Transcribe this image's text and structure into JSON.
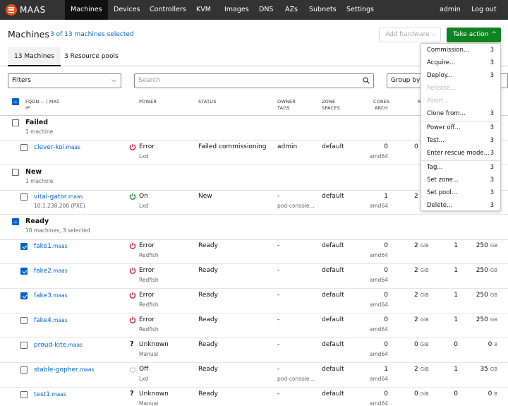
{
  "brand": {
    "name": "MAAS",
    "accent": "#e95420"
  },
  "nav": {
    "items": [
      "Machines",
      "Devices",
      "Controllers",
      "KVM",
      "Images",
      "DNS",
      "AZs",
      "Subnets",
      "Settings"
    ],
    "user": "admin",
    "logout": "Log out"
  },
  "header": {
    "title": "Machines",
    "selection": "3 of 13 machines selected",
    "add_hardware": "Add hardware",
    "take_action": "Take action"
  },
  "tabs": [
    "13 Machines",
    "3 Resource pools"
  ],
  "filters": {
    "label": "Filters",
    "search_placeholder": "Search",
    "group_by": "Group by s"
  },
  "columns": {
    "fqdn": "FQDN",
    "mac": "| MAC",
    "ip": "IP",
    "power": "POWER",
    "status": "STATUS",
    "owner": "OWNER",
    "tags": "TAGS",
    "zone": "ZONE",
    "spaces": "SPACES",
    "cores": "CORES",
    "arch": "ARCH",
    "ram_partial": "R"
  },
  "groups": [
    {
      "name": "Failed",
      "count": "1 machine"
    },
    {
      "name": "New",
      "count": "1 machine"
    },
    {
      "name": "Ready",
      "count": "10 machines, 3 selected"
    }
  ],
  "machines": [
    {
      "host": "clever-koi",
      "domain": ".maas",
      "ip": "",
      "power": "Error",
      "power_type": "Lxd",
      "status": "Failed commissioning",
      "owner": "admin",
      "tags": "",
      "zone": "default",
      "cores": "0",
      "arch": "amd64",
      "ram": "0",
      "ram_unit": "",
      "disks": "",
      "storage": "",
      "storage_unit": "",
      "checked": false
    },
    {
      "host": "vital-gator",
      "domain": ".maas",
      "ip": "10.1.238.200 (PXE)",
      "power": "On",
      "power_type": "Lxd",
      "status": "New",
      "owner": "-",
      "tags": "pod-console...",
      "zone": "default",
      "cores": "1",
      "arch": "amd64",
      "ram": "2",
      "ram_unit": "",
      "disks": "",
      "storage": "",
      "storage_unit": "",
      "checked": false
    },
    {
      "host": "fake1",
      "domain": ".maas",
      "ip": "",
      "power": "Error",
      "power_type": "Redfish",
      "status": "Ready",
      "owner": "-",
      "tags": "",
      "zone": "default",
      "cores": "0",
      "arch": "amd64",
      "ram": "2",
      "ram_unit": "GiB",
      "disks": "1",
      "storage": "250",
      "storage_unit": "GB",
      "checked": true
    },
    {
      "host": "fake2",
      "domain": ".maas",
      "ip": "",
      "power": "Error",
      "power_type": "Redfish",
      "status": "Ready",
      "owner": "-",
      "tags": "",
      "zone": "default",
      "cores": "0",
      "arch": "amd64",
      "ram": "2",
      "ram_unit": "GiB",
      "disks": "1",
      "storage": "250",
      "storage_unit": "GB",
      "checked": true
    },
    {
      "host": "fake3",
      "domain": ".maas",
      "ip": "",
      "power": "Error",
      "power_type": "Redfish",
      "status": "Ready",
      "owner": "-",
      "tags": "",
      "zone": "default",
      "cores": "0",
      "arch": "amd64",
      "ram": "2",
      "ram_unit": "GiB",
      "disks": "1",
      "storage": "250",
      "storage_unit": "GB",
      "checked": true
    },
    {
      "host": "fake4",
      "domain": ".maas",
      "ip": "",
      "power": "Error",
      "power_type": "Redfish",
      "status": "Ready",
      "owner": "-",
      "tags": "",
      "zone": "default",
      "cores": "0",
      "arch": "amd64",
      "ram": "2",
      "ram_unit": "GiB",
      "disks": "1",
      "storage": "250",
      "storage_unit": "GB",
      "checked": false
    },
    {
      "host": "proud-kite",
      "domain": ".maas",
      "ip": "",
      "power": "Unknown",
      "power_type": "Manual",
      "status": "Ready",
      "owner": "-",
      "tags": "",
      "zone": "default",
      "cores": "0",
      "arch": "amd64",
      "ram": "0",
      "ram_unit": "GiB",
      "disks": "0",
      "storage": "0",
      "storage_unit": "B",
      "checked": false
    },
    {
      "host": "stable-gopher",
      "domain": ".maas",
      "ip": "",
      "power": "Off",
      "power_type": "Lxd",
      "status": "Ready",
      "owner": "-",
      "tags": "pod-console...",
      "zone": "default",
      "cores": "1",
      "arch": "amd64",
      "ram": "2",
      "ram_unit": "GiB",
      "disks": "1",
      "storage": "35",
      "storage_unit": "GB",
      "checked": false
    },
    {
      "host": "test1",
      "domain": ".maas",
      "ip": "",
      "power": "Unknown",
      "power_type": "Manual",
      "status": "Ready",
      "owner": "-",
      "tags": "",
      "zone": "default",
      "cores": "0",
      "arch": "amd64",
      "ram": "0",
      "ram_unit": "GiB",
      "disks": "0",
      "storage": "0",
      "storage_unit": "B",
      "checked": false
    }
  ],
  "power_colors": {
    "error": "#c7162b",
    "on": "#0e8420",
    "off": "#cccccc"
  },
  "menu": [
    {
      "label": "Commission...",
      "count": "3",
      "disabled": false
    },
    {
      "label": "Acquire...",
      "count": "3",
      "disabled": false
    },
    {
      "label": "Deploy...",
      "count": "3",
      "disabled": false
    },
    {
      "label": "Release...",
      "count": "",
      "disabled": true
    },
    {
      "label": "Abort...",
      "count": "",
      "disabled": true
    },
    {
      "label": "Clone from...",
      "count": "3",
      "disabled": false
    },
    {
      "label": "Power off...",
      "count": "3",
      "disabled": false
    },
    {
      "label": "Test...",
      "count": "3",
      "disabled": false
    },
    {
      "label": "Enter rescue mode...",
      "count": "3",
      "disabled": false
    },
    {
      "label": "Tag...",
      "count": "3",
      "disabled": false
    },
    {
      "label": "Set zone...",
      "count": "3",
      "disabled": false
    },
    {
      "label": "Set pool...",
      "count": "3",
      "disabled": false
    },
    {
      "label": "Delete...",
      "count": "3",
      "disabled": false
    }
  ]
}
